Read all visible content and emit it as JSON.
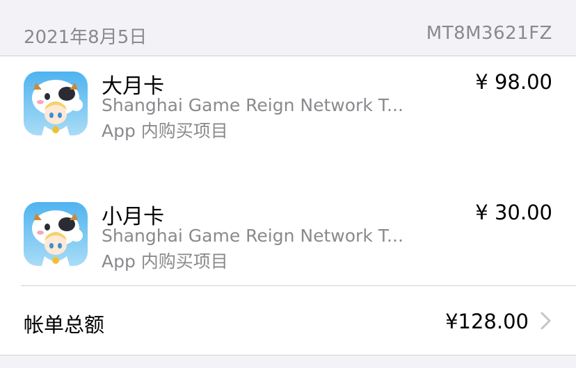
{
  "header": {
    "date": "2021年8月5日",
    "order_id": "MT8M3621FZ"
  },
  "items": [
    {
      "title": "大月卡",
      "developer": "Shanghai Game Reign Network T...",
      "type": "App 内购买项目",
      "price": "¥ 98.00",
      "icon": "game-app-icon"
    },
    {
      "title": "小月卡",
      "developer": "Shanghai Game Reign Network T...",
      "type": "App 内购买项目",
      "price": "¥ 30.00",
      "icon": "game-app-icon"
    }
  ],
  "total": {
    "label": "帐单总额",
    "amount": "¥128.00",
    "icon": "chevron-right-icon"
  },
  "colors": {
    "background": "#f2f2f7",
    "secondary_text": "#8a8a8e",
    "separator": "#d1d1d6",
    "primary_text": "#000000"
  }
}
